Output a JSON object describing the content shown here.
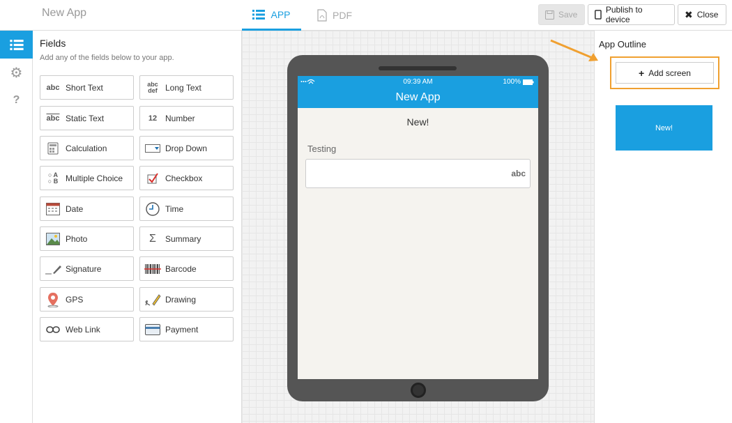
{
  "header": {
    "app_title": "New App",
    "tabs": [
      {
        "label": "APP",
        "icon": "list-icon",
        "active": true
      },
      {
        "label": "PDF",
        "icon": "pdf-icon",
        "active": false
      }
    ],
    "save_label": "Save",
    "publish_label": "Publish to device",
    "close_label": "Close"
  },
  "rail": {
    "items": [
      {
        "icon": "list-icon",
        "active": true
      },
      {
        "icon": "gear-icon",
        "active": false
      },
      {
        "icon": "question-icon",
        "active": false
      }
    ]
  },
  "fields": {
    "title": "Fields",
    "subtitle": "Add any of the fields below to your app.",
    "items": [
      {
        "label": "Short Text",
        "icon": "abc-icon"
      },
      {
        "label": "Long Text",
        "icon": "abc-def-icon"
      },
      {
        "label": "Static Text",
        "icon": "static-text-icon"
      },
      {
        "label": "Number",
        "icon": "number-icon"
      },
      {
        "label": "Calculation",
        "icon": "calculator-icon"
      },
      {
        "label": "Drop Down",
        "icon": "dropdown-icon"
      },
      {
        "label": "Multiple Choice",
        "icon": "multiple-choice-icon"
      },
      {
        "label": "Checkbox",
        "icon": "checkbox-icon"
      },
      {
        "label": "Date",
        "icon": "calendar-icon"
      },
      {
        "label": "Time",
        "icon": "clock-icon"
      },
      {
        "label": "Photo",
        "icon": "photo-icon"
      },
      {
        "label": "Summary",
        "icon": "sigma-icon"
      },
      {
        "label": "Signature",
        "icon": "signature-icon"
      },
      {
        "label": "Barcode",
        "icon": "barcode-icon"
      },
      {
        "label": "GPS",
        "icon": "map-pin-icon"
      },
      {
        "label": "Drawing",
        "icon": "pencil-icon"
      },
      {
        "label": "Web Link",
        "icon": "link-icon"
      },
      {
        "label": "Payment",
        "icon": "credit-card-icon"
      }
    ]
  },
  "preview": {
    "time": "09:39 AM",
    "battery": "100%",
    "nav_title": "New App",
    "screen_heading": "New!",
    "field_label": "Testing",
    "field_type_badge": "abc"
  },
  "outline": {
    "title": "App Outline",
    "add_screen_label": "Add screen",
    "screens": [
      {
        "label": "New!"
      }
    ]
  },
  "colors": {
    "accent": "#1a9fe0",
    "highlight": "#f0a030"
  }
}
